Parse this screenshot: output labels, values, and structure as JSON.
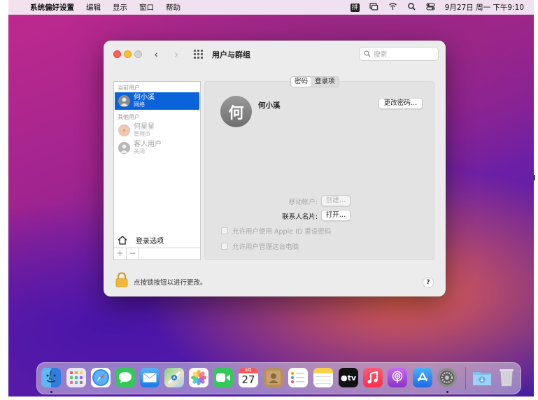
{
  "menubar": {
    "apple": "",
    "app_name": "系统偏好设置",
    "menus": [
      "编辑",
      "显示",
      "窗口",
      "帮助"
    ],
    "ime": "拼",
    "datetime": "9月27日 周一 下午9:10"
  },
  "window": {
    "title": "用户与群组",
    "search_placeholder": "搜索",
    "sidebar": {
      "current_section": "当前用户",
      "other_section": "其他用户",
      "users": [
        {
          "name": "何小溪",
          "role": "网络",
          "selected": true
        },
        {
          "name": "何星星",
          "role": "管理员",
          "selected": false
        },
        {
          "name": "客人用户",
          "role": "关闭",
          "selected": false
        }
      ],
      "login_options": "登录选项",
      "add": "+",
      "remove": "−"
    },
    "tabs": [
      {
        "label": "密码",
        "active": true
      },
      {
        "label": "登录项",
        "active": false
      }
    ],
    "avatar_char": "何",
    "user_name": "何小溪",
    "change_password": "更改密码…",
    "mobile_account_label": "移动帐户:",
    "create_button": "创建…",
    "contact_card_label": "联系人名片:",
    "open_button": "打开…",
    "allow_reset_appleid": "允许用户使用 Apple ID 重设密码",
    "allow_admin": "允许用户管理这台电脑",
    "lock_text": "点按锁按钮以进行更改。",
    "help": "?"
  },
  "dock": {
    "calendar_month": "9月",
    "calendar_day": "27",
    "tv_label": "tv",
    "items": [
      "finder-icon",
      "launchpad-icon",
      "safari-icon",
      "messages-icon",
      "mail-icon",
      "maps-icon",
      "photos-icon",
      "facetime-icon",
      "calendar-icon",
      "contacts-icon",
      "reminders-icon",
      "notes-icon",
      "tv-icon",
      "music-icon",
      "podcasts-icon",
      "app-store-icon",
      "system-preferences-icon",
      "downloads-folder-icon",
      "trash-icon"
    ]
  }
}
